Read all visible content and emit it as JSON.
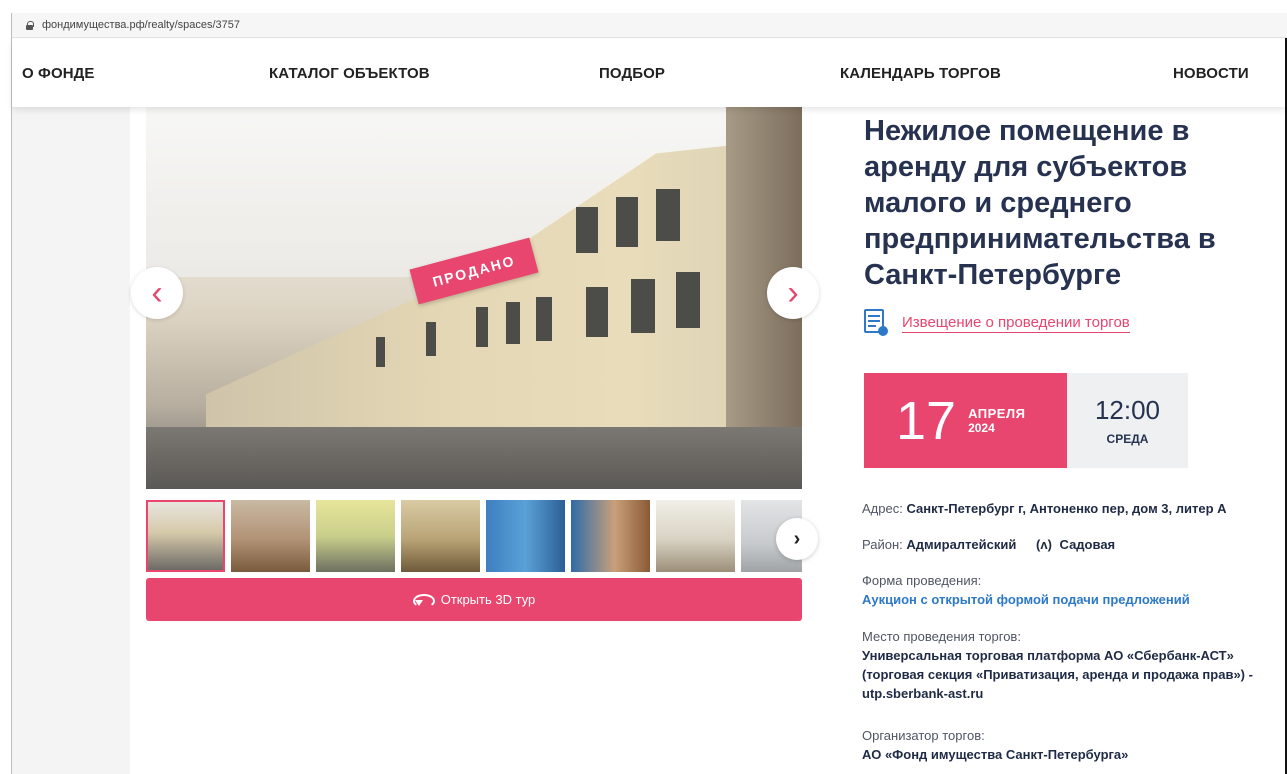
{
  "browser": {
    "url": "фондимущества.рф/realty/spaces/3757"
  },
  "nav": {
    "items": [
      "О ФОНДЕ",
      "КАТАЛОГ ОБЪЕКТОВ",
      "ПОДБОР",
      "КАЛЕНДАРЬ ТОРГОВ",
      "НОВОСТИ"
    ]
  },
  "gallery": {
    "sold_label": "ПРОДАНО",
    "prev_icon": "chevron-left-icon",
    "next_icon": "chevron-right-icon",
    "tour_button": "Открыть 3D тур"
  },
  "listing": {
    "title": "Нежилое помещение в аренду для субъектов малого и среднего предпринимательства в Санкт-Петербурге",
    "notice_link": "Извещение о проведении торгов",
    "date": {
      "day": "17",
      "month": "АПРЕЛЯ",
      "year": "2024",
      "time": "12:00",
      "weekday": "СРЕДА"
    },
    "address_label": "Адрес:",
    "address": "Санкт-Петербург г, Антоненко пер, дом 3, литер А",
    "district_label": "Район:",
    "district": "Адмиралтейский",
    "metro": "Садовая",
    "form_label": "Форма проведения:",
    "form_value": "Аукцион с открытой формой подачи предложений",
    "place_label": "Место проведения торгов:",
    "place_value": "Универсальная торговая платформа АО «Сбербанк-АСТ» (торговая секция «Приватизация, аренда и продажа прав») - utp.sberbank-ast.ru",
    "organizer_label": "Организатор торгов:",
    "organizer_value": "АО «Фонд имущества Санкт-Петербурга»"
  },
  "colors": {
    "accent": "#e8456f",
    "title": "#263250",
    "link": "#2d79c7"
  }
}
